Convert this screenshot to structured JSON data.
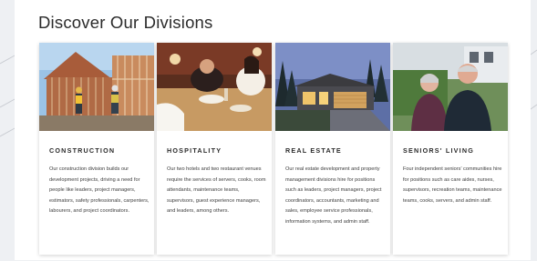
{
  "heading": "Discover Our Divisions",
  "divisions": [
    {
      "title": "CONSTRUCTION",
      "description": "Our construction division builds our development projects, driving a need for people like leaders, project managers, estimators, safety professionals, carpenters, labourers, and project coordinators.",
      "image": "construction-workers-photo"
    },
    {
      "title": "HOSPITALITY",
      "description": "Our two hotels and two restaurant venues require the services of servers, cooks, room attendants, maintenance teams, supervisors, guest experience managers, and leaders, among others.",
      "image": "restaurant-dining-photo"
    },
    {
      "title": "REAL ESTATE",
      "description": "Our real estate development and property management divisions hire for positions such as leaders, project managers, project coordinators, accountants, marketing and sales, employee service professionals, information systems, and admin staff.",
      "image": "house-at-dusk-photo"
    },
    {
      "title": "SENIORS' LIVING",
      "description": "Four independent seniors' communities hire for positions such as care aides, nurses, supervisors, recreation teams, maintenance teams, cooks, servers, and admin staff.",
      "image": "senior-couple-photo"
    }
  ]
}
